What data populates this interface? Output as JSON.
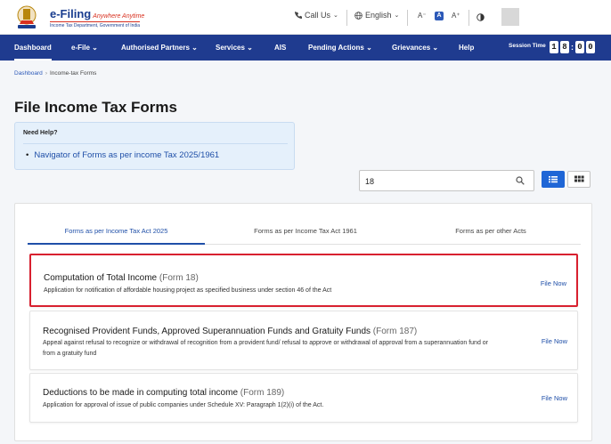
{
  "header": {
    "brand": "e-Filing",
    "tagline": "Anywhere Anytime",
    "subtitle": "Income Tax Department, Government of India",
    "call_us": "Call Us",
    "language": "English",
    "font_decrease": "A⁻",
    "font_normal": "A",
    "font_increase": "A⁺"
  },
  "nav": {
    "items": [
      "Dashboard",
      "e-File",
      "Authorised Partners",
      "Services",
      "AIS",
      "Pending Actions",
      "Grievances",
      "Help"
    ],
    "session_label": "Session Time",
    "timer": [
      "1",
      "8",
      "0",
      "0"
    ]
  },
  "breadcrumb": {
    "home": "Dashboard",
    "current": "Income-tax Forms"
  },
  "page": {
    "title": "File Income Tax Forms"
  },
  "help": {
    "heading": "Need Help?",
    "link": "Navigator of Forms as per income Tax 2025/1961"
  },
  "search": {
    "value": "18"
  },
  "tabs": [
    "Forms as per Income Tax Act 2025",
    "Forms as per Income Tax Act 1961",
    "Forms as per other Acts"
  ],
  "forms": [
    {
      "title": "Computation of Total Income",
      "form": "(Form 18)",
      "description": "Application for notification of affordable housing project as specified business under section 46 of the Act",
      "action": "File Now"
    },
    {
      "title": "Recognised Provident Funds, Approved Superannuation Funds and Gratuity Funds",
      "form": "(Form 187)",
      "description": "Appeal against refusal to recognize or withdrawal of recognition from a provident fund/ refusal to approve or withdrawal of approval from a superannuation fund or from a gratuity fund",
      "action": "File Now"
    },
    {
      "title": "Deductions to be made in computing total income",
      "form": "(Form 189)",
      "description": "Application for approval of issue of public companies under Schedule XV: Paragraph 1(2)(i) of the Act.",
      "action": "File Now"
    }
  ],
  "colors": {
    "nav_bg": "#1f3b8f",
    "accent": "#1f4fa8",
    "highlight": "#d8202f",
    "help_bg": "#e5f0fb"
  }
}
